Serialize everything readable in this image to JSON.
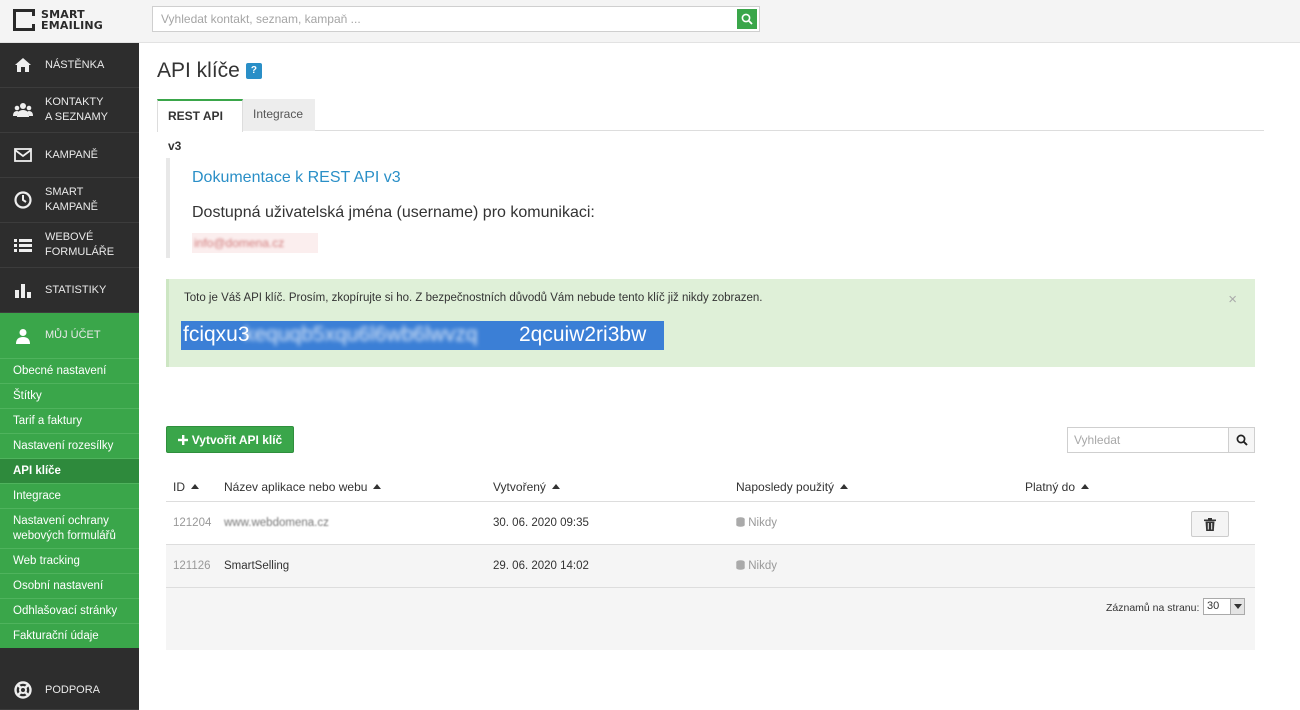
{
  "brand": {
    "line1": "SMART",
    "line2": "EMAILING"
  },
  "search": {
    "placeholder": "Vyhledat kontakt, seznam, kampaň ..."
  },
  "sidebar": {
    "items": [
      {
        "label": "NÁSTĚNKA",
        "icon": "home-icon"
      },
      {
        "label": "KONTAKTY\nA SEZNAMY",
        "icon": "users-icon"
      },
      {
        "label": "KAMPANĚ",
        "icon": "envelope-icon"
      },
      {
        "label": "SMART\nKAMPANĚ",
        "icon": "clock-icon"
      },
      {
        "label": "WEBOVÉ\nFORMULÁŘE",
        "icon": "list-icon"
      },
      {
        "label": "STATISTIKY",
        "icon": "bar-chart-icon"
      },
      {
        "label": "MŮJ ÚČET",
        "icon": "user-icon"
      }
    ],
    "submenu": [
      "Obecné nastavení",
      "Štítky",
      "Tarif a faktury",
      "Nastavení rozesílky",
      "API klíče",
      "Integrace",
      "Nastavení ochrany webových formulářů",
      "Web tracking",
      "Osobní nastavení",
      "Odhlašovací stránky",
      "Fakturační údaje"
    ],
    "support": "PODPORA"
  },
  "page": {
    "title": "API klíče",
    "help": "?"
  },
  "tabs": [
    "REST API v3",
    "Integrace"
  ],
  "doc": {
    "link": "Dokumentace k REST API v3",
    "subtitle": "Dostupná uživatelská jména (username) pro komunikaci:",
    "username": "info@domena.cz"
  },
  "alert": {
    "text": "Toto je Váš API klíč. Prosím, zkopírujte si ho. Z bezpečnostních důvodů Vám nebude tento klíč již nikdy zobrazen.",
    "close": "×",
    "key_start": "fciqxu3",
    "key_mid": "kequqb5xqu6l6wb6lwvzq",
    "key_end": "2qcuiw2ri3bw"
  },
  "actions": {
    "create": "Vytvořit API klíč",
    "search_placeholder": "Vyhledat"
  },
  "table": {
    "headers": [
      "ID",
      "Název aplikace nebo webu",
      "Vytvořený",
      "Naposledy použitý",
      "Platný do"
    ],
    "rows": [
      {
        "id": "121204",
        "name": "www.webdomena.cz",
        "created": "30. 06. 2020 09:35",
        "last_used": "Nikdy",
        "valid": ""
      },
      {
        "id": "121126",
        "name": "SmartSelling",
        "created": "29. 06. 2020 14:02",
        "last_used": "Nikdy",
        "valid": ""
      }
    ],
    "per_page_label": "Záznamů na stranu:",
    "per_page_value": "30"
  },
  "colors": {
    "accent": "#3aa64a",
    "link": "#2a8fc7",
    "sidebar": "#2d2d2d",
    "alert_bg": "#dff0d8",
    "highlight": "#3b7fd6"
  }
}
